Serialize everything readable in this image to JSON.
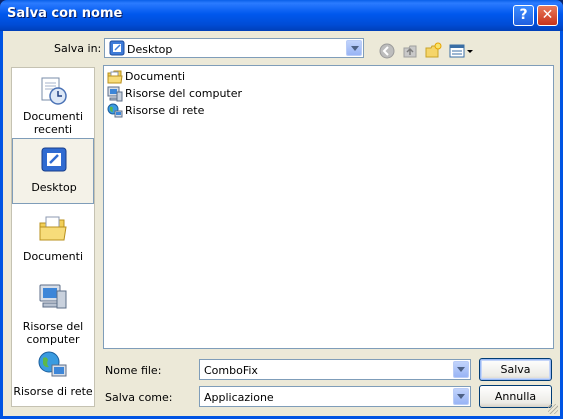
{
  "window": {
    "title": "Salva con nome",
    "help_glyph": "?",
    "close_glyph": "✕"
  },
  "toolbar": {
    "save_in_label": "Salva in:",
    "location": "Desktop",
    "icons": [
      "back-icon",
      "up-folder-icon",
      "new-folder-icon",
      "views-menu-icon"
    ]
  },
  "places_bar": {
    "items": [
      {
        "label": "Documenti recenti",
        "icon": "recent-documents-icon"
      },
      {
        "label": "Desktop",
        "icon": "desktop-icon",
        "selected": true
      },
      {
        "label": "Documenti",
        "icon": "documents-folder-icon"
      },
      {
        "label": "Risorse del computer",
        "icon": "my-computer-icon"
      },
      {
        "label": "Risorse di rete",
        "icon": "network-places-icon"
      }
    ]
  },
  "file_list": {
    "items": [
      {
        "name": "Documenti",
        "icon": "folder-icon"
      },
      {
        "name": "Risorse del computer",
        "icon": "computer-icon"
      },
      {
        "name": "Risorse di rete",
        "icon": "network-icon"
      }
    ]
  },
  "form": {
    "filename_label": "Nome file:",
    "filename_value": "ComboFix",
    "filetype_label": "Salva come:",
    "filetype_value": "Applicazione",
    "save_button": "Salva",
    "cancel_button": "Annulla"
  }
}
